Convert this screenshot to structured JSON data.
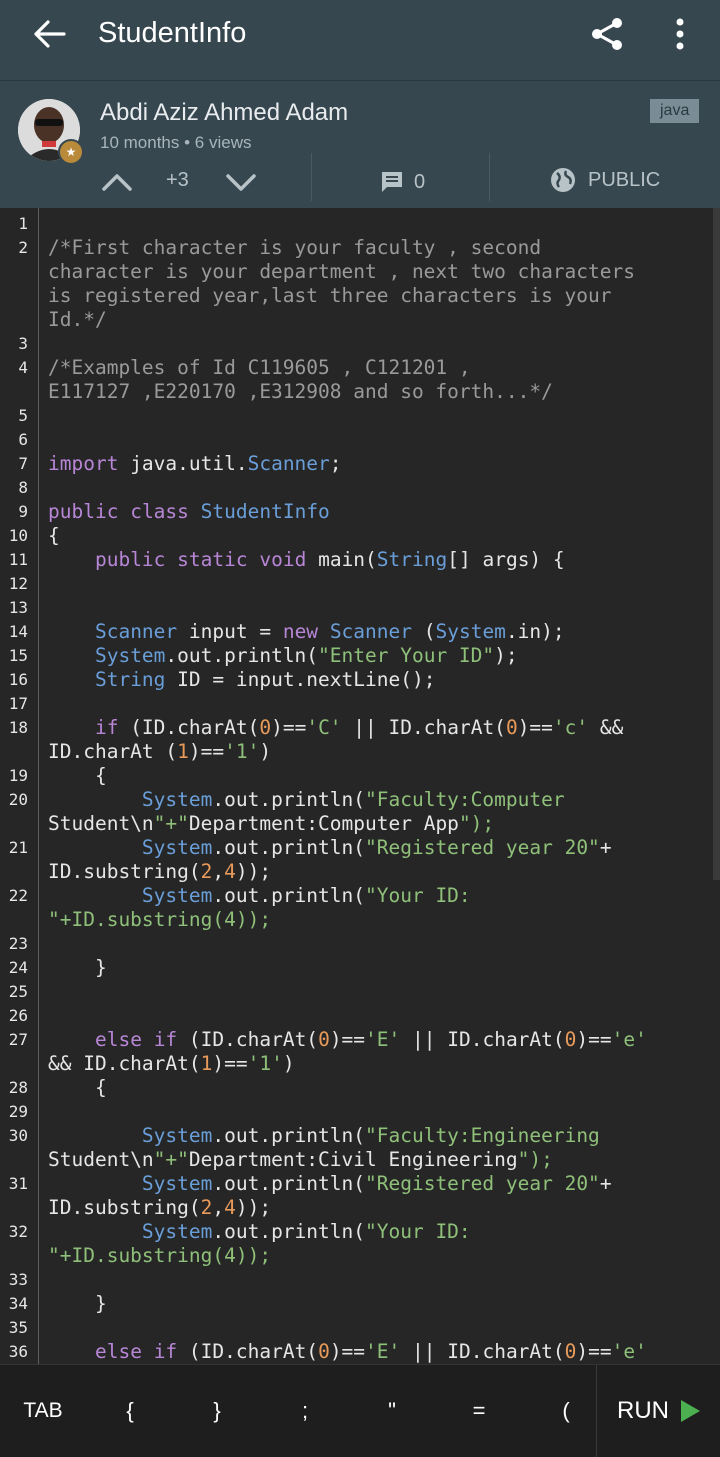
{
  "appbar": {
    "title": "StudentInfo"
  },
  "post": {
    "author": "Abdi Aziz Ahmed Adam",
    "meta": "10 months • 6 views",
    "language": "java",
    "vote_count": "+3",
    "comment_count": "0",
    "visibility": "PUBLIC"
  },
  "code_lines": [
    {
      "n": "1",
      "text": ""
    },
    {
      "n": "2",
      "text": "/*First character is your faculty , second\ncharacter is your department , next two characters\nis registered year,last three characters is your\nId.*/"
    },
    {
      "n": "3",
      "text": ""
    },
    {
      "n": "4",
      "text": "/*Examples of Id C119605 , C121201 ,\nE117127 ,E220170 ,E312908 and so forth...*/"
    },
    {
      "n": "5",
      "text": ""
    },
    {
      "n": "6",
      "text": ""
    },
    {
      "n": "7",
      "text": "import java.util.Scanner;"
    },
    {
      "n": "8",
      "text": ""
    },
    {
      "n": "9",
      "text": "public class StudentInfo"
    },
    {
      "n": "10",
      "text": "{"
    },
    {
      "n": "11",
      "text": "    public static void main(String[] args) {"
    },
    {
      "n": "12",
      "text": ""
    },
    {
      "n": "13",
      "text": ""
    },
    {
      "n": "14",
      "text": "    Scanner input = new Scanner (System.in);"
    },
    {
      "n": "15",
      "text": "    System.out.println(\"Enter Your ID\");"
    },
    {
      "n": "16",
      "text": "    String ID = input.nextLine();"
    },
    {
      "n": "17",
      "text": ""
    },
    {
      "n": "18",
      "text": "    if (ID.charAt(0)=='C' || ID.charAt(0)=='c' &&\nID.charAt (1)=='1')"
    },
    {
      "n": "19",
      "text": "    {"
    },
    {
      "n": "20",
      "text": "        System.out.println(\"Faculty:Computer\nStudent\\n\"+\"Department:Computer App\");"
    },
    {
      "n": "21",
      "text": "        System.out.println(\"Registered year 20\"+\nID.substring(2,4));"
    },
    {
      "n": "22",
      "text": "        System.out.println(\"Your ID:\n\"+ID.substring(4));"
    },
    {
      "n": "23",
      "text": ""
    },
    {
      "n": "24",
      "text": "    }"
    },
    {
      "n": "25",
      "text": ""
    },
    {
      "n": "26",
      "text": ""
    },
    {
      "n": "27",
      "text": "    else if (ID.charAt(0)=='E' || ID.charAt(0)=='e'\n&& ID.charAt(1)=='1')"
    },
    {
      "n": "28",
      "text": "    {"
    },
    {
      "n": "29",
      "text": ""
    },
    {
      "n": "30",
      "text": "        System.out.println(\"Faculty:Engineering\nStudent\\n\"+\"Department:Civil Engineering\");"
    },
    {
      "n": "31",
      "text": "        System.out.println(\"Registered year 20\"+\nID.substring(2,4));"
    },
    {
      "n": "32",
      "text": "        System.out.println(\"Your ID:\n\"+ID.substring(4));"
    },
    {
      "n": "33",
      "text": ""
    },
    {
      "n": "34",
      "text": "    }"
    },
    {
      "n": "35",
      "text": ""
    },
    {
      "n": "36",
      "text": "    else if (ID.charAt(0)=='E' || ID.charAt(0)=='e'"
    }
  ],
  "toolbar": {
    "tab": "TAB",
    "brace_open": "{",
    "brace_close": "}",
    "semicolon": ";",
    "quote": "\"",
    "equals": "=",
    "paren_open": "(",
    "run": "RUN"
  },
  "colors": {
    "appbar_bg": "#36474f",
    "editor_bg": "#262626",
    "keyword": "#b886d6",
    "type": "#6a9ed8",
    "string": "#8fc07a",
    "number": "#e89a5a",
    "comment": "#9a9a9a",
    "run_icon": "#4caf50"
  }
}
